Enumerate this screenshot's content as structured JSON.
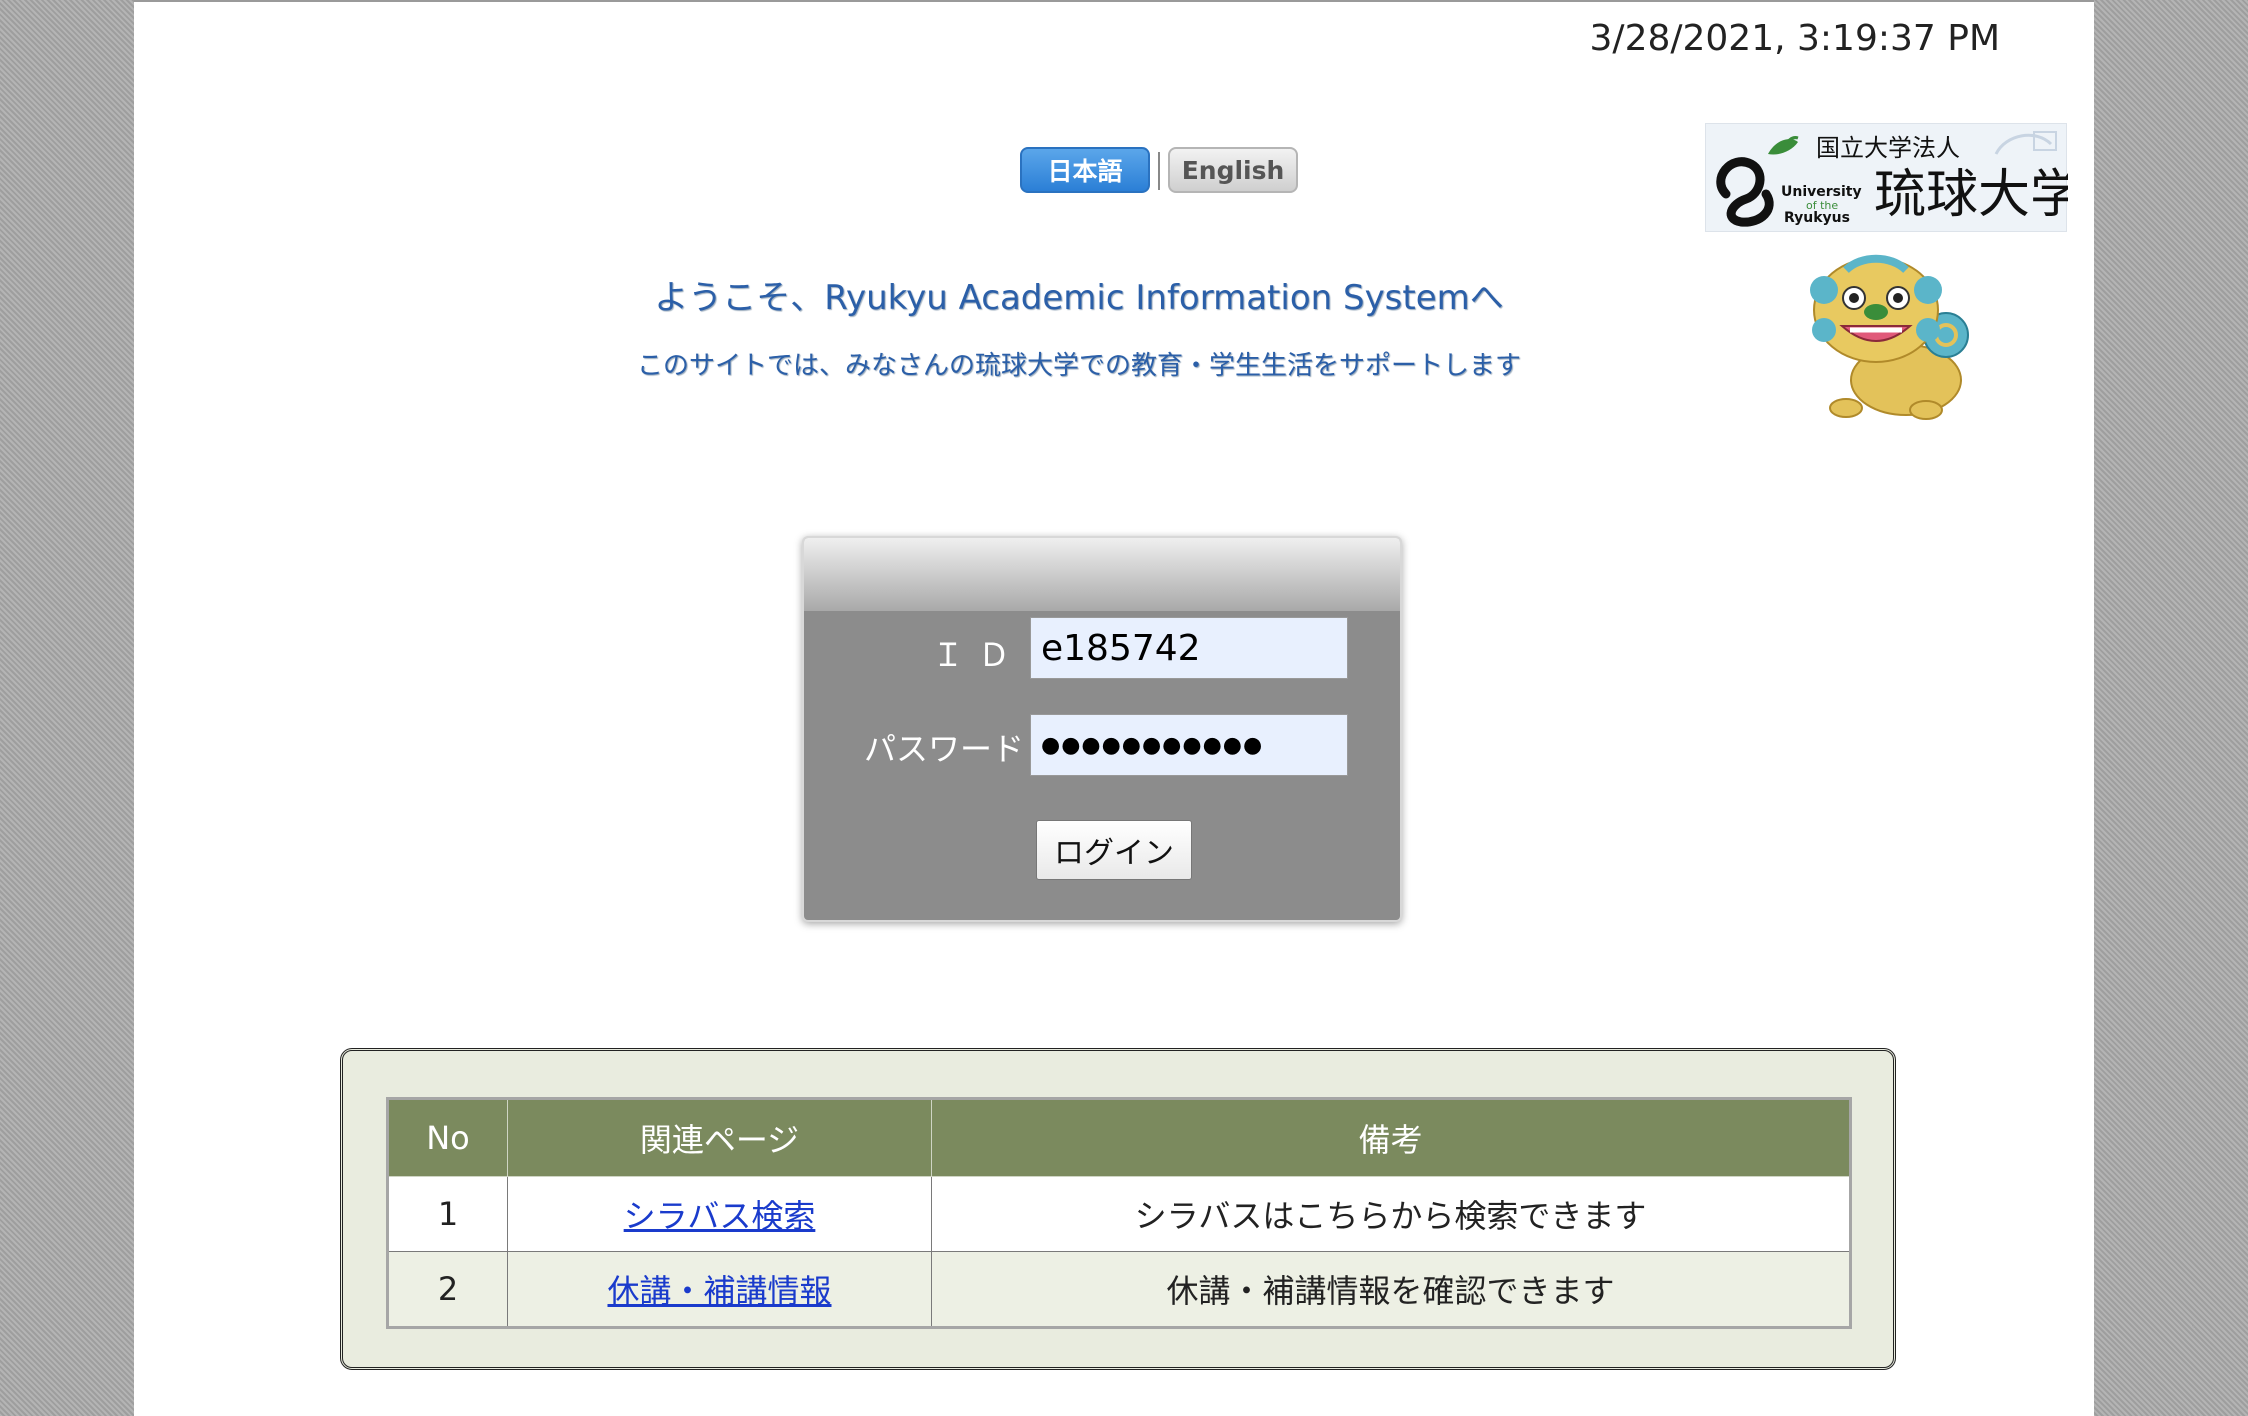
{
  "datetime": "3/28/2021, 3:19:37 PM",
  "language": {
    "japanese": "日本語",
    "english": "English",
    "active": "japanese"
  },
  "logo": {
    "corp_text": "国立大学法人",
    "name_jp": "琉球大学",
    "name_en_1": "University",
    "name_en_2": "of the",
    "name_en_3": "Ryukyus"
  },
  "welcome": "ようこそ、Ryukyu Academic Information Systemへ",
  "subtitle": "このサイトでは、みなさんの琉球大学での教育・学生生活をサポートします",
  "login": {
    "id_label": "ＩＤ",
    "id_value": "e185742",
    "password_label": "パスワード",
    "password_value": "●●●●●●●●●●●",
    "button": "ログイン"
  },
  "links_table": {
    "headers": [
      "No",
      "関連ページ",
      "備考"
    ],
    "rows": [
      {
        "no": "1",
        "link": "シラバス検索",
        "note": "シラバスはこちらから検索できます"
      },
      {
        "no": "2",
        "link": "休講・補講情報",
        "note": "休講・補講情報を確認できます"
      }
    ]
  },
  "colors": {
    "accent_blue": "#2b5fa8",
    "table_header": "#7b8a5e",
    "panel_bg": "#e9ecdf",
    "link": "#1a3bcc"
  }
}
